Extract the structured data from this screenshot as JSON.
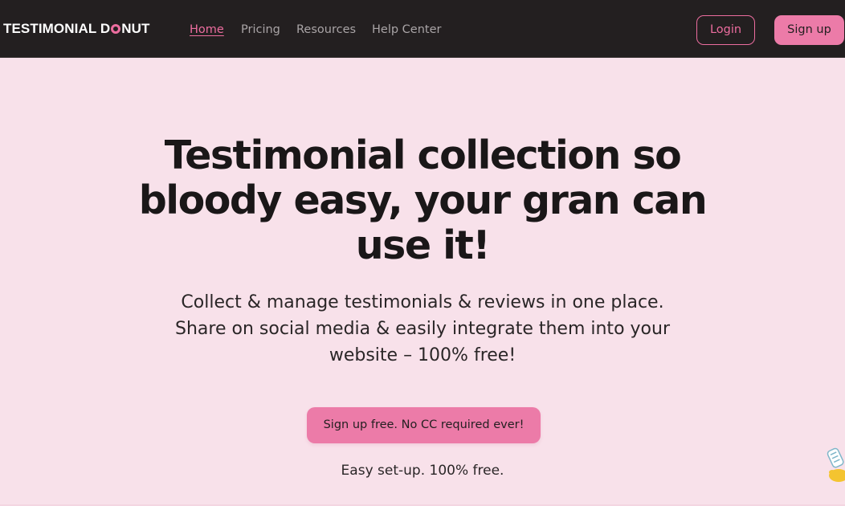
{
  "header": {
    "logo_before": "TESTIMONIAL D",
    "logo_after": "NUT",
    "nav": [
      {
        "label": "Home",
        "active": true
      },
      {
        "label": "Pricing",
        "active": false
      },
      {
        "label": "Resources",
        "active": false
      },
      {
        "label": "Help Center",
        "active": false
      }
    ],
    "login_label": "Login",
    "signup_label": "Sign up"
  },
  "hero": {
    "title": "Testimonial collection so bloody easy, your gran can use it!",
    "subtitle": "Collect & manage testimonials & reviews in one place. Share on social media & easily integrate them into your website – 100% free!",
    "cta_label": "Sign up free. No CC required ever!",
    "cta_note": "Easy set-up. 100% free."
  },
  "colors": {
    "accent": "#ec7ba8",
    "accent_text": "#ec6d9f",
    "navbar": "#231f20",
    "background": "#f8e1ea"
  },
  "icons": {
    "logo_o": "donut-icon",
    "corner": "waving-hand-icon"
  }
}
